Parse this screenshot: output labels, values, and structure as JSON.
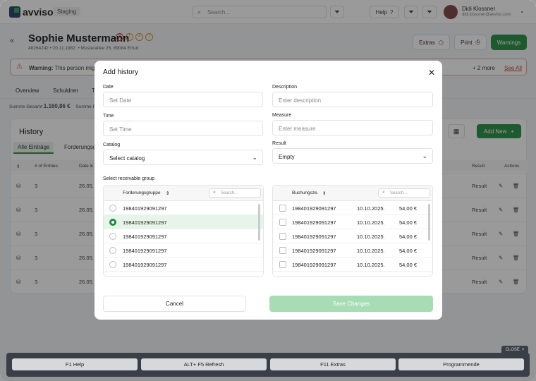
{
  "app": {
    "logo_text": "avviso",
    "env": "Staging",
    "search_placeholder": "Search...",
    "help_label": "Help"
  },
  "user": {
    "name": "Didi Klossner",
    "email": "didi.klossner@avviso.com"
  },
  "person": {
    "name": "Sophie Mustermann",
    "meta": "48264242  •  20.11.1982.  •  Musterallee 25, 89084 Erfurt"
  },
  "header_actions": {
    "extras": "Extras",
    "print": "Print",
    "warnings": "Warnings"
  },
  "warning": {
    "label": "Warning:",
    "text": "This person migh",
    "more": "+ 2 more",
    "see_all": "See All"
  },
  "tabs": [
    "Overview",
    "Schuldner",
    "T"
  ],
  "summary": {
    "label": "Summe Gesamt",
    "value": "1.160,86 €",
    "label2": "Summe F"
  },
  "history": {
    "title": "History",
    "add_new": "Add New",
    "tabs": [
      "Alle Einträge",
      "Forderungsg"
    ],
    "columns": [
      "# of Entries",
      "Date &",
      "Result",
      "Actions"
    ],
    "rows": [
      {
        "entries": "3",
        "date": "26.05.",
        "result": "Result"
      },
      {
        "entries": "3",
        "date": "26.05.",
        "result": "Result"
      },
      {
        "entries": "3",
        "date": "26.05.",
        "result": "Result"
      },
      {
        "entries": "3",
        "date": "26.05.",
        "result": "Result"
      },
      {
        "entries": "3",
        "date": "26.05.",
        "result": "Result"
      }
    ]
  },
  "modal": {
    "title": "Add history",
    "date": {
      "label": "Date",
      "placeholder": "Set Date"
    },
    "description": {
      "label": "Description",
      "placeholder": "Enter description"
    },
    "time": {
      "label": "Time",
      "placeholder": "Set Time"
    },
    "measure": {
      "label": "Measure",
      "placeholder": "Enter measure"
    },
    "catalog": {
      "label": "Catalog",
      "value": "Select catalog"
    },
    "result": {
      "label": "Result",
      "value": "Empty"
    },
    "group_label": "Select receivable group",
    "left_list": {
      "header": "Forderungsgruppe",
      "search_placeholder": "Search...",
      "items": [
        "198401929091297",
        "198401929091297",
        "198401929091297",
        "198401929091297",
        "198401929091297"
      ],
      "selected_index": 1
    },
    "right_list": {
      "header": "Buchungsze.",
      "search_placeholder": "Search...",
      "items": [
        {
          "id": "198401929091297",
          "date": "10.10.2025.",
          "amount": "54,00 €"
        },
        {
          "id": "198401929091297",
          "date": "10.10.2025.",
          "amount": "54,00 €"
        },
        {
          "id": "198401929091297",
          "date": "10.10.2025.",
          "amount": "54,00 €"
        },
        {
          "id": "198401929091297",
          "date": "10.10.2025.",
          "amount": "54,00 €"
        },
        {
          "id": "198401929091297",
          "date": "10.10.2025.",
          "amount": "54,00 €"
        }
      ]
    },
    "cancel": "Cancel",
    "save": "Save Changes"
  },
  "fkeys": {
    "close": "CLOSE",
    "items": [
      "F1 Help",
      "ALT+ F5 Refresh",
      "F11 Extras",
      "Programmende"
    ]
  }
}
